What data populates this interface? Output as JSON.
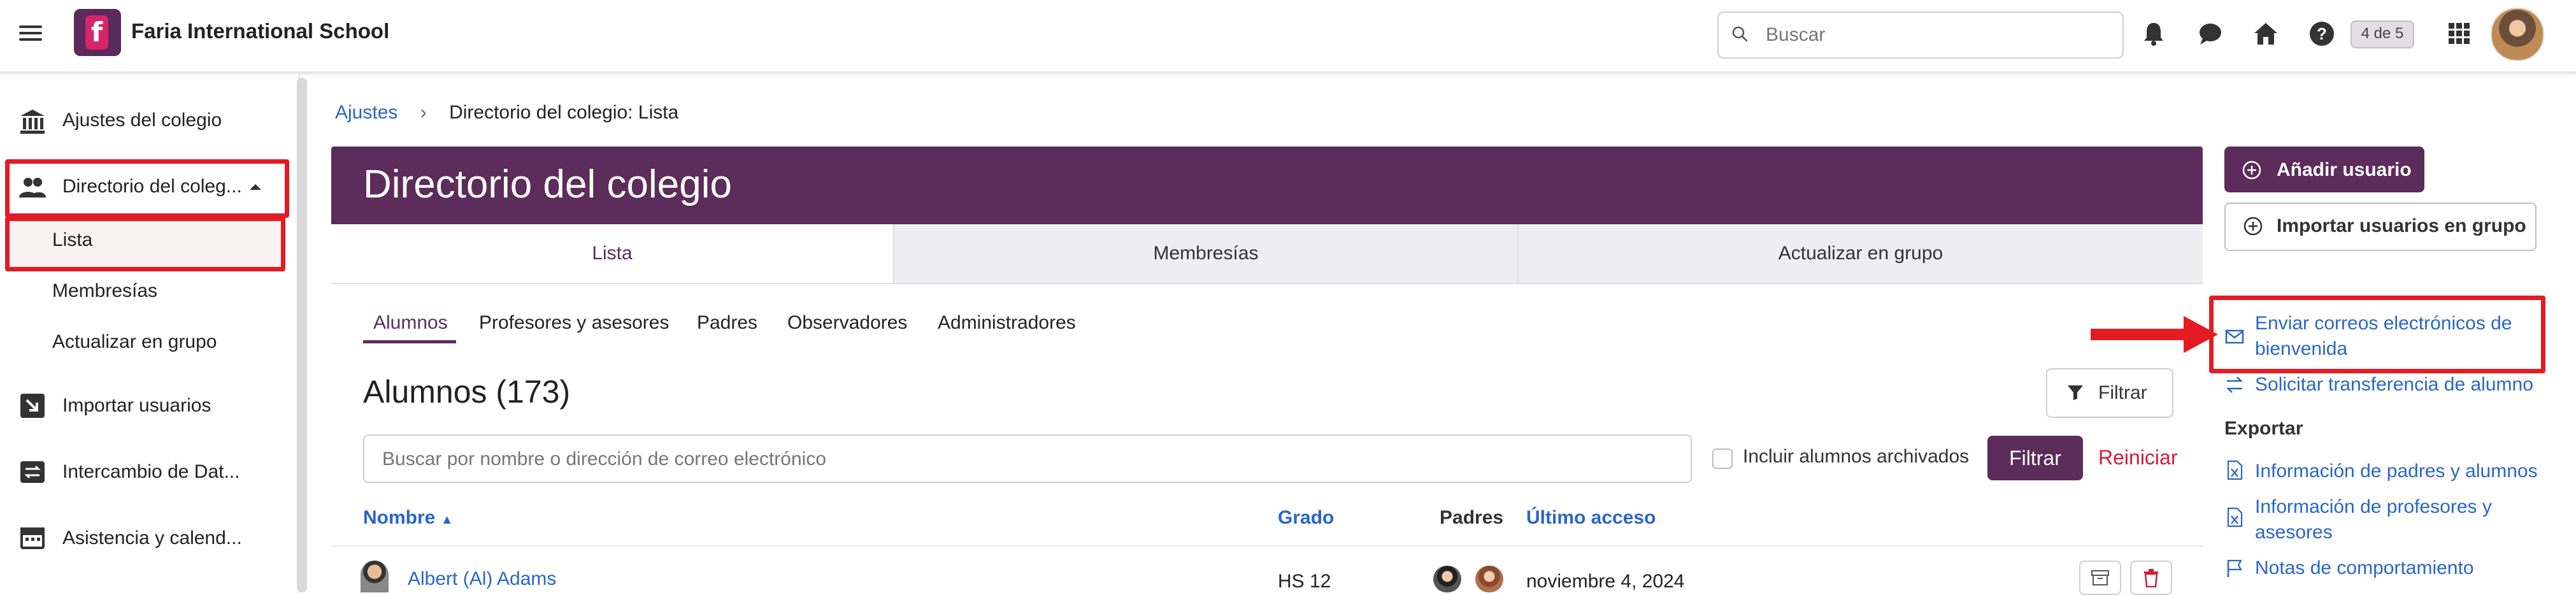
{
  "topbar": {
    "school_name": "Faria International School",
    "logo_letter": "f",
    "search_placeholder": "Buscar",
    "badge": "4 de 5"
  },
  "sidebar": {
    "items": [
      {
        "label": "Ajustes del colegio"
      },
      {
        "label": "Directorio del coleg..."
      },
      {
        "label": "Lista"
      },
      {
        "label": "Membresías"
      },
      {
        "label": "Actualizar en grupo"
      },
      {
        "label": "Importar usuarios"
      },
      {
        "label": "Intercambio de Dat..."
      },
      {
        "label": "Asistencia y calend..."
      }
    ]
  },
  "breadcrumb": {
    "parent": "Ajustes",
    "current": "Directorio del colegio: Lista"
  },
  "main": {
    "title": "Directorio del colegio",
    "tabs": [
      {
        "label": "Lista"
      },
      {
        "label": "Membresías"
      },
      {
        "label": "Actualizar en grupo"
      }
    ],
    "subtabs": [
      {
        "label": "Alumnos"
      },
      {
        "label": "Profesores y asesores"
      },
      {
        "label": "Padres"
      },
      {
        "label": "Observadores"
      },
      {
        "label": "Administradores"
      }
    ],
    "section_title": "Alumnos (173)",
    "filter_button": "Filtrar",
    "search_placeholder": "Buscar por nombre o dirección de correo electrónico",
    "include_archived": "Incluir alumnos archivados",
    "filter_submit": "Filtrar",
    "reset": "Reiniciar",
    "columns": {
      "name": "Nombre",
      "grade": "Grado",
      "parents": "Padres",
      "last_access": "Último acceso"
    },
    "rows": [
      {
        "name": "Albert (Al) Adams",
        "grade": "HS 12",
        "last_access": "noviembre 4, 2024"
      }
    ]
  },
  "right_panel": {
    "add_user": "Añadir usuario",
    "import_group": "Importar usuarios en grupo",
    "send_welcome_line1": "Enviar correos electrónicos de",
    "send_welcome_line2": "bienvenida",
    "request_transfer": "Solicitar transferencia de alumno",
    "export_label": "Exportar",
    "export_parents_students": "Información de padres y alumnos",
    "export_teachers_line1": "Información de profesores y",
    "export_teachers_line2": "asesores",
    "behavior_notes": "Notas de comportamiento"
  },
  "colors": {
    "brand": "#5c2c5a",
    "link": "#2a66c8",
    "highlight": "#e41b23",
    "reset": "#d31e3a"
  }
}
